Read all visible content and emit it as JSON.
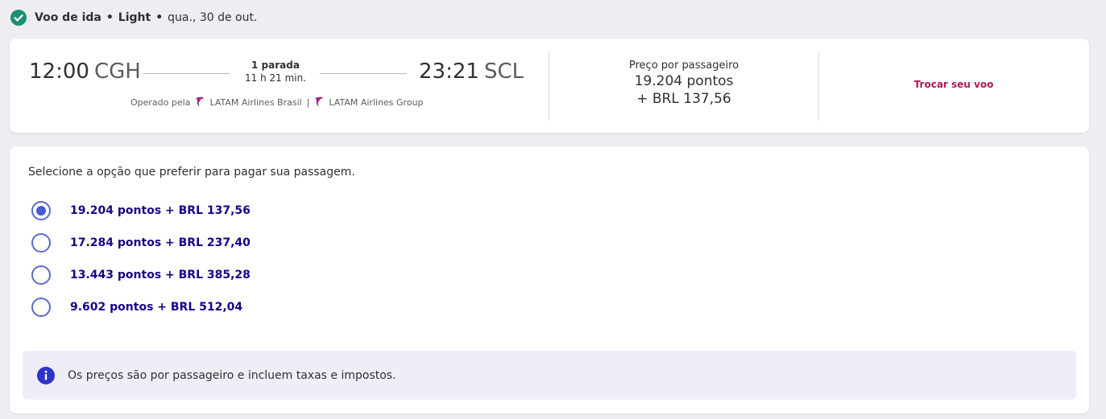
{
  "header": {
    "icon": "check-circle-icon",
    "leg_label": "Voo de ida",
    "sep1": "•",
    "fare_label": "Light",
    "sep2": "•",
    "date": "qua., 30 de out."
  },
  "flight": {
    "departure_time": "12:00",
    "departure_code": "CGH",
    "arrival_time": "23:21",
    "arrival_code": "SCL",
    "stops": "1 parada",
    "duration": "11 h 21 min.",
    "operated_by_label": "Operado pela",
    "operator_1": "LATAM Airlines Brasil",
    "operator_sep": "|",
    "operator_2": "LATAM Airlines Group",
    "price_label": "Preço por passageiro",
    "price_points": "19.204 pontos",
    "price_money": "+ BRL 137,56",
    "change_flight_label": "Trocar seu voo"
  },
  "payment": {
    "prompt": "Selecione a opção que preferir para pagar sua passagem.",
    "options": [
      {
        "label": "19.204 pontos + BRL 137,56",
        "selected": true
      },
      {
        "label": "17.284 pontos + BRL 237,40",
        "selected": false
      },
      {
        "label": "13.443 pontos + BRL 385,28",
        "selected": false
      },
      {
        "label": "9.602 pontos + BRL 512,04",
        "selected": false
      }
    ],
    "info_icon": "info-icon",
    "info_text": "Os preços são por passageiro e incluem taxas e impostos."
  },
  "colors": {
    "accent": "#1b0088",
    "radio": "#4a5bd8",
    "link": "#b01a54",
    "check": "#1b8f74",
    "info_bg": "#efeef8"
  }
}
